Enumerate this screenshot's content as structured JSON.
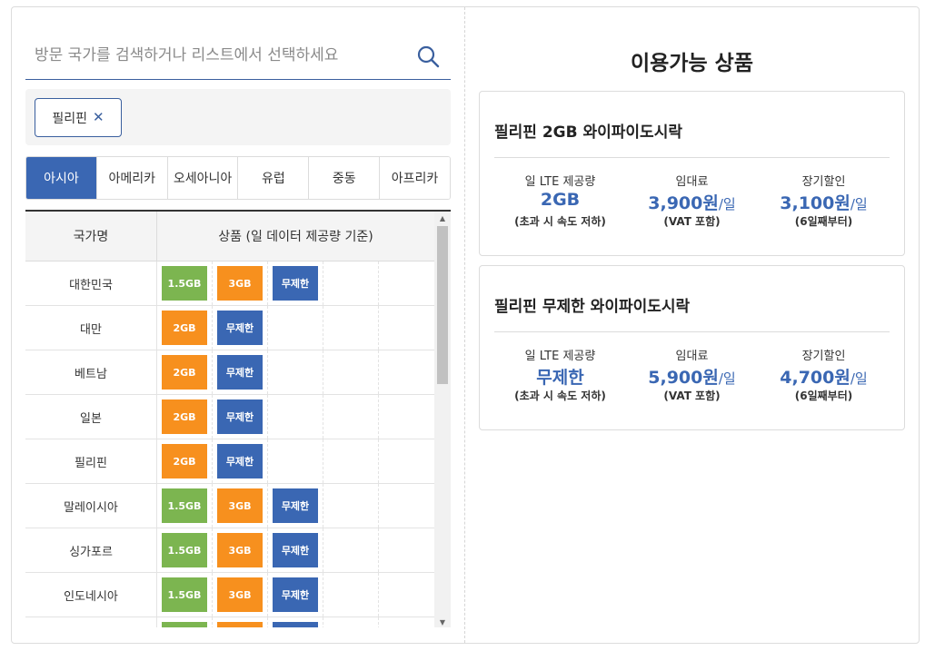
{
  "search": {
    "placeholder": "방문 국가를 검색하거나 리스트에서 선택하세요"
  },
  "selected_tags": [
    {
      "label": "필리핀"
    }
  ],
  "tabs": [
    {
      "label": "아시아",
      "active": true
    },
    {
      "label": "아메리카"
    },
    {
      "label": "오세아니아"
    },
    {
      "label": "유럽"
    },
    {
      "label": "중동"
    },
    {
      "label": "아프리카"
    }
  ],
  "table": {
    "header_country": "국가명",
    "header_product": "상품 (일 데이터 제공량 기준)",
    "rows": [
      {
        "country": "대한민국",
        "products": [
          "1.5GB",
          "3GB",
          "무제한"
        ]
      },
      {
        "country": "대만",
        "products": [
          "2GB",
          "무제한"
        ]
      },
      {
        "country": "베트남",
        "products": [
          "2GB",
          "무제한"
        ]
      },
      {
        "country": "일본",
        "products": [
          "2GB",
          "무제한"
        ]
      },
      {
        "country": "필리핀",
        "products": [
          "2GB",
          "무제한"
        ]
      },
      {
        "country": "말레이시아",
        "products": [
          "1.5GB",
          "3GB",
          "무제한"
        ]
      },
      {
        "country": "싱가포르",
        "products": [
          "1.5GB",
          "3GB",
          "무제한"
        ]
      },
      {
        "country": "인도네시아",
        "products": [
          "1.5GB",
          "3GB",
          "무제한"
        ]
      },
      {
        "country": "",
        "products": [
          "",
          "",
          ""
        ]
      }
    ]
  },
  "badge_colors": {
    "1.5GB": "#7cb550",
    "3GB": "#f7901e",
    "2GB": "#f7901e",
    "무제한": "#3a67b3"
  },
  "available": {
    "title": "이용가능 상품",
    "cards": [
      {
        "name": "필리핀 2GB 와이파이도시락",
        "data_label": "일 LTE 제공량",
        "data_value": "2GB",
        "data_note": "(초과 시 속도 저하)",
        "rent_label": "임대료",
        "rent_value": "3,900원",
        "rent_unit": "/일",
        "rent_note": "(VAT 포함)",
        "discount_label": "장기할인",
        "discount_value": "3,100원",
        "discount_unit": "/일",
        "discount_note": "(6일째부터)"
      },
      {
        "name": "필리핀 무제한 와이파이도시락",
        "data_label": "일 LTE 제공량",
        "data_value": "무제한",
        "data_note": "(초과 시 속도 저하)",
        "rent_label": "임대료",
        "rent_value": "5,900원",
        "rent_unit": "/일",
        "rent_note": "(VAT 포함)",
        "discount_label": "장기할인",
        "discount_value": "4,700원",
        "discount_unit": "/일",
        "discount_note": "(6일째부터)"
      }
    ]
  }
}
